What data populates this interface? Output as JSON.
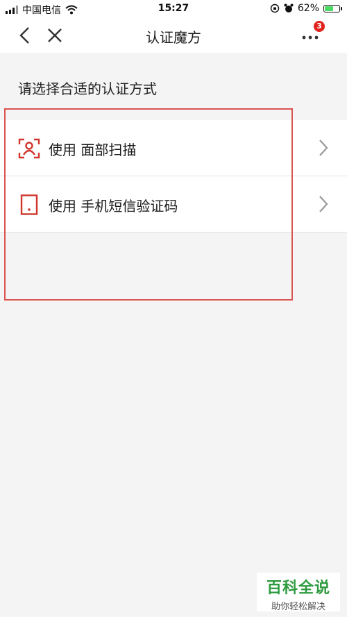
{
  "status_bar": {
    "carrier": "中国电信",
    "time": "15:27",
    "battery_text": "62%",
    "battery_level": 0.62
  },
  "nav": {
    "title": "认证魔方",
    "badge_count": "3"
  },
  "section_label": "请选择合适的认证方式",
  "options": [
    {
      "prefix": "使用",
      "name": "面部扫描",
      "icon": "face-scan-icon"
    },
    {
      "prefix": "使用",
      "name": "手机短信验证码",
      "icon": "phone-sms-icon"
    }
  ],
  "watermark": {
    "main": "百科全说",
    "sub": "助你轻松解决"
  },
  "colors": {
    "accent": "#d0352b",
    "badge": "#e0231c",
    "watermark_green": "#2e9a3f"
  }
}
